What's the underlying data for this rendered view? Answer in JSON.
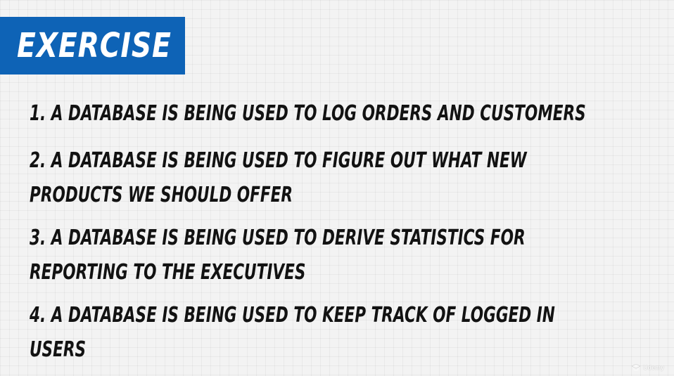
{
  "title": "EXERCISE",
  "items": [
    {
      "lines": [
        "1. A DATABASE IS BEING USED TO LOG ORDERS AND CUSTOMERS"
      ]
    },
    {
      "lines": [
        "2. A DATABASE IS BEING USED TO FIGURE OUT WHAT NEW",
        "PRODUCTS WE SHOULD OFFER"
      ]
    },
    {
      "lines": [
        "3. A DATABASE IS BEING USED TO DERIVE STATISTICS FOR",
        "REPORTING TO THE EXECUTIVES"
      ]
    },
    {
      "lines": [
        "4. A DATABASE IS BEING USED TO KEEP TRACK OF LOGGED IN",
        "USERS"
      ]
    }
  ],
  "watermark": {
    "text": "Udemy",
    "icon": "udemy-logo-icon"
  },
  "colors": {
    "accent": "#0e63b6",
    "text": "#121212",
    "background": "#f3f3f3"
  }
}
